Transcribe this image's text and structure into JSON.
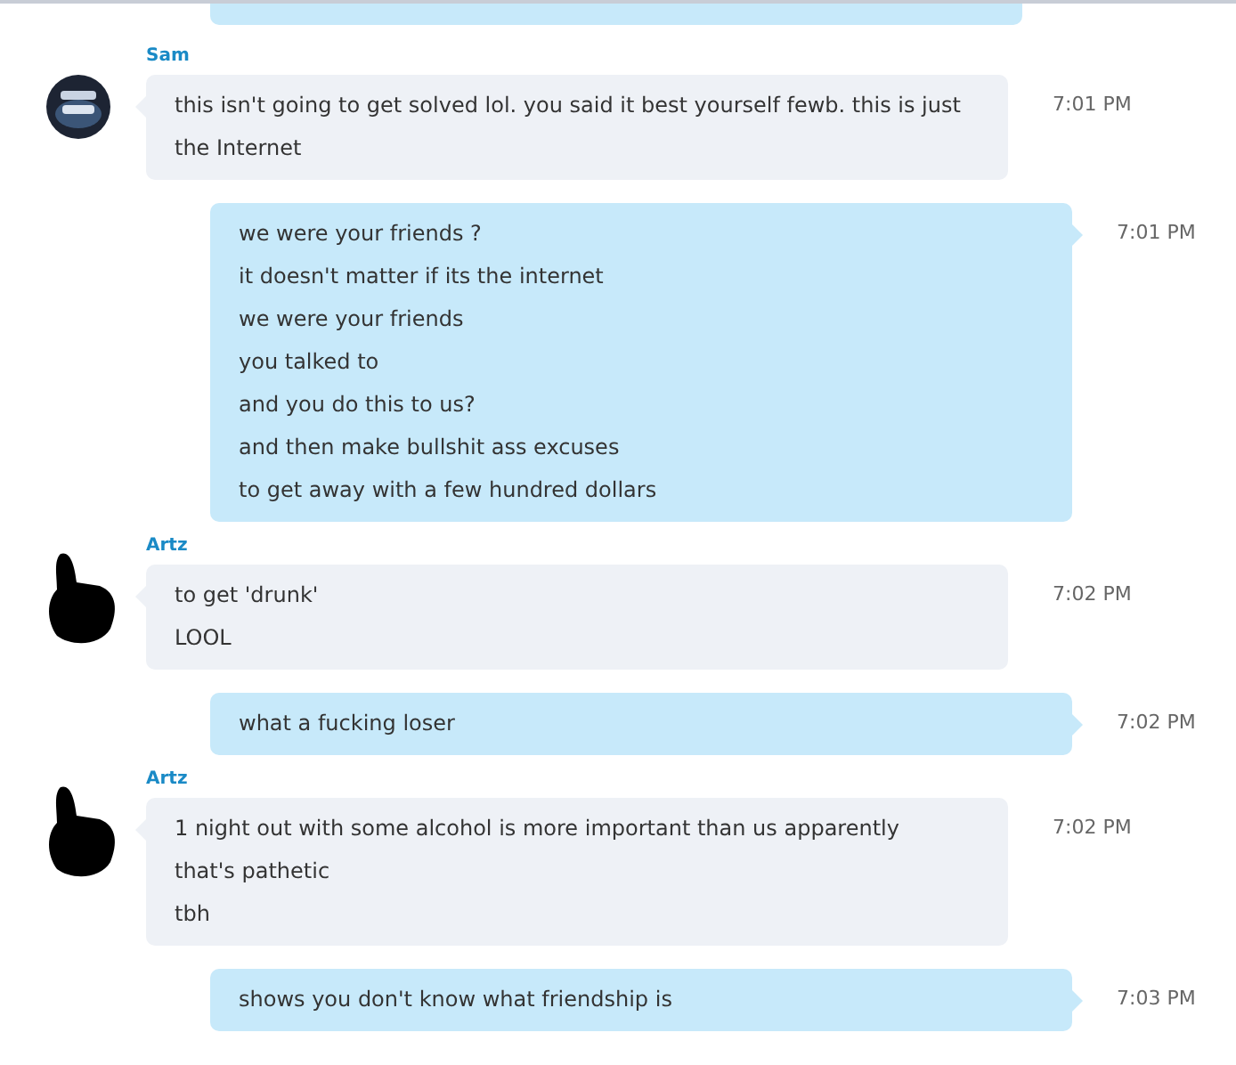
{
  "messages": [
    {
      "kind": "outgoing",
      "partial": true
    },
    {
      "kind": "incoming",
      "sender": "Sam",
      "avatar_redacted": false,
      "time": "7:01 PM",
      "lines": [
        "this isn't going to get solved lol. you said it best yourself fewb. this is just the Internet"
      ]
    },
    {
      "kind": "outgoing",
      "time": "7:01 PM",
      "lines": [
        "we were your friends ?",
        "it doesn't matter if its the internet",
        "we were your friends",
        "you talked to",
        "and you do this to us?",
        "and then make bullshit ass excuses",
        "to get away with a few hundred dollars"
      ]
    },
    {
      "kind": "incoming",
      "sender": "Artz",
      "avatar_redacted": true,
      "time": "7:02 PM",
      "lines": [
        "to get 'drunk'",
        "LOOL"
      ]
    },
    {
      "kind": "outgoing",
      "time": "7:02 PM",
      "lines": [
        "what a fucking loser"
      ]
    },
    {
      "kind": "incoming",
      "sender": "Artz",
      "avatar_redacted": true,
      "time": "7:02 PM",
      "lines": [
        "1 night out with some alcohol is more important than us apparently",
        "that's pathetic",
        "tbh"
      ]
    },
    {
      "kind": "outgoing",
      "time": "7:03 PM",
      "lines": [
        "shows you don't know what friendship is"
      ]
    }
  ]
}
